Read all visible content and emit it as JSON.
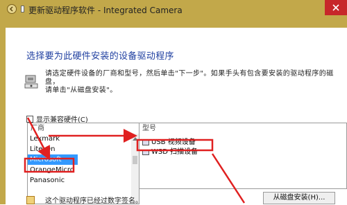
{
  "window": {
    "title": "更新驱动程序软件 - Integrated Camera",
    "accent_color": "#c2a84a"
  },
  "dialog": {
    "heading": "选择要为此硬件安装的设备驱动程序",
    "instruction_line1": "请选定硬件设备的厂商和型号，然后单击\"下一步\"。如果手头有包含要安装的驱动程序的磁盘，",
    "instruction_line2": "请单击\"从磁盘安装\"。",
    "compat_label": "显示兼容硬件(C)",
    "manufacturer_header": "厂商",
    "manufacturers": [
      "Lexmark",
      "Lite-On",
      "Microsoft",
      "OrangeMicro",
      "Panasonic"
    ],
    "selected_manufacturer": "Microsoft",
    "model_header": "型号",
    "models": [
      "USB 视频设备",
      "WSD 扫描设备"
    ],
    "signed_text": "这个驱动程序已经过数字签名。",
    "have_disk_button": "从磁盘安装(H)..."
  },
  "annotation_color": "#e02020"
}
